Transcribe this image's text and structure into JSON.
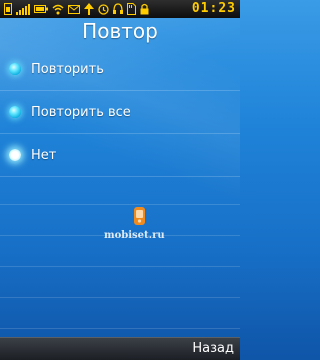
{
  "status_bar": {
    "time": "01:23",
    "icons": [
      "sim-icon",
      "signal-icon",
      "battery-icon",
      "wifi-icon",
      "message-icon",
      "network-icon",
      "alarm-icon",
      "headset-icon",
      "sd-card-icon",
      "lock-icon"
    ],
    "time_color": "#ffcc00"
  },
  "screen": {
    "title": "Повтор"
  },
  "options": [
    {
      "label": "Повторить",
      "selected": false
    },
    {
      "label": "Повторить все",
      "selected": false
    },
    {
      "label": "Нет",
      "selected": true
    }
  ],
  "watermark": {
    "text": "mobiset.ru"
  },
  "softkeys": {
    "right": "Назад"
  },
  "colors": {
    "background_top": "#3a9be6",
    "background_bottom": "#0f55a8",
    "radio_glow": "#63e6ff",
    "logo_orange": "#f08a1c"
  }
}
